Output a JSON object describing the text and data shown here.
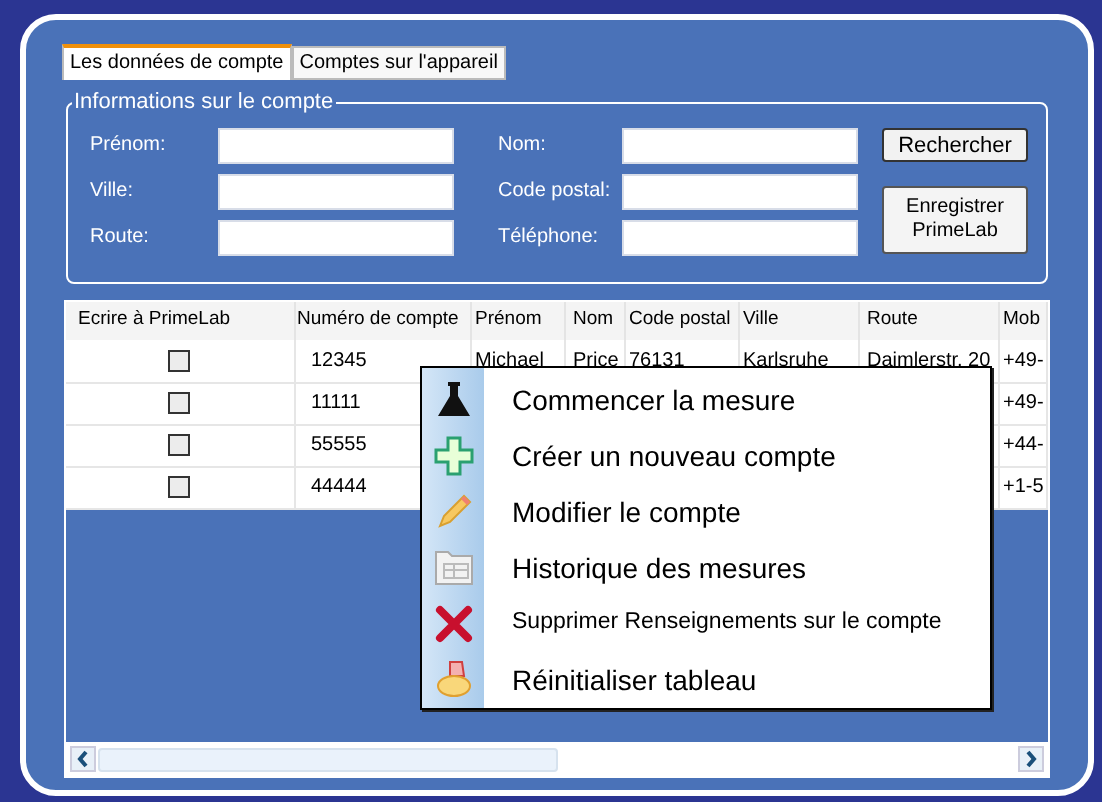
{
  "tabs": [
    {
      "label": "Les données de compte",
      "selected": true
    },
    {
      "label": "Comptes sur l'appareil",
      "selected": false
    }
  ],
  "account_info": {
    "title": "Informations sur le compte",
    "fields": [
      {
        "label": "Prénom:"
      },
      {
        "label": "Nom:"
      },
      {
        "label": "Ville:"
      },
      {
        "label": "Code postal:"
      },
      {
        "label": "Route:"
      },
      {
        "label": "Téléphone:"
      }
    ],
    "buttons": [
      "Rechercher",
      "Enregistrer PrimeLab"
    ]
  },
  "table": {
    "checkbox_column": "Ecrire à PrimeLab",
    "columns": [
      "Numéro de compte",
      "Prénom",
      "Nom",
      "Code postal",
      "Ville",
      "Route",
      "Mob"
    ],
    "rows": [
      {
        "checked": false,
        "cells": [
          "12345",
          "Michael",
          "Price",
          "76131",
          "Karlsruhe",
          "Daimlerstr. 20",
          "+49-"
        ]
      },
      {
        "checked": false,
        "cells": [
          "11111",
          "",
          "",
          "",
          "",
          "",
          "+49-"
        ]
      },
      {
        "checked": false,
        "cells": [
          "55555",
          "",
          "",
          "",
          "",
          "",
          "+44-"
        ]
      },
      {
        "checked": false,
        "cells": [
          "44444",
          "",
          "",
          "",
          "",
          "",
          "+1-5"
        ]
      }
    ]
  },
  "context_menu": [
    {
      "kind": "start",
      "label": "Commencer la mesure"
    },
    {
      "kind": "create",
      "label": "Créer un nouveau compte"
    },
    {
      "kind": "edit",
      "label": "Modifier le compte"
    },
    {
      "kind": "history",
      "label": "Historique des mesures"
    },
    {
      "kind": "delete",
      "label": "Supprimer Renseignements sur le compte"
    },
    {
      "kind": "reset",
      "label": "Réinitialiser tableau"
    }
  ]
}
